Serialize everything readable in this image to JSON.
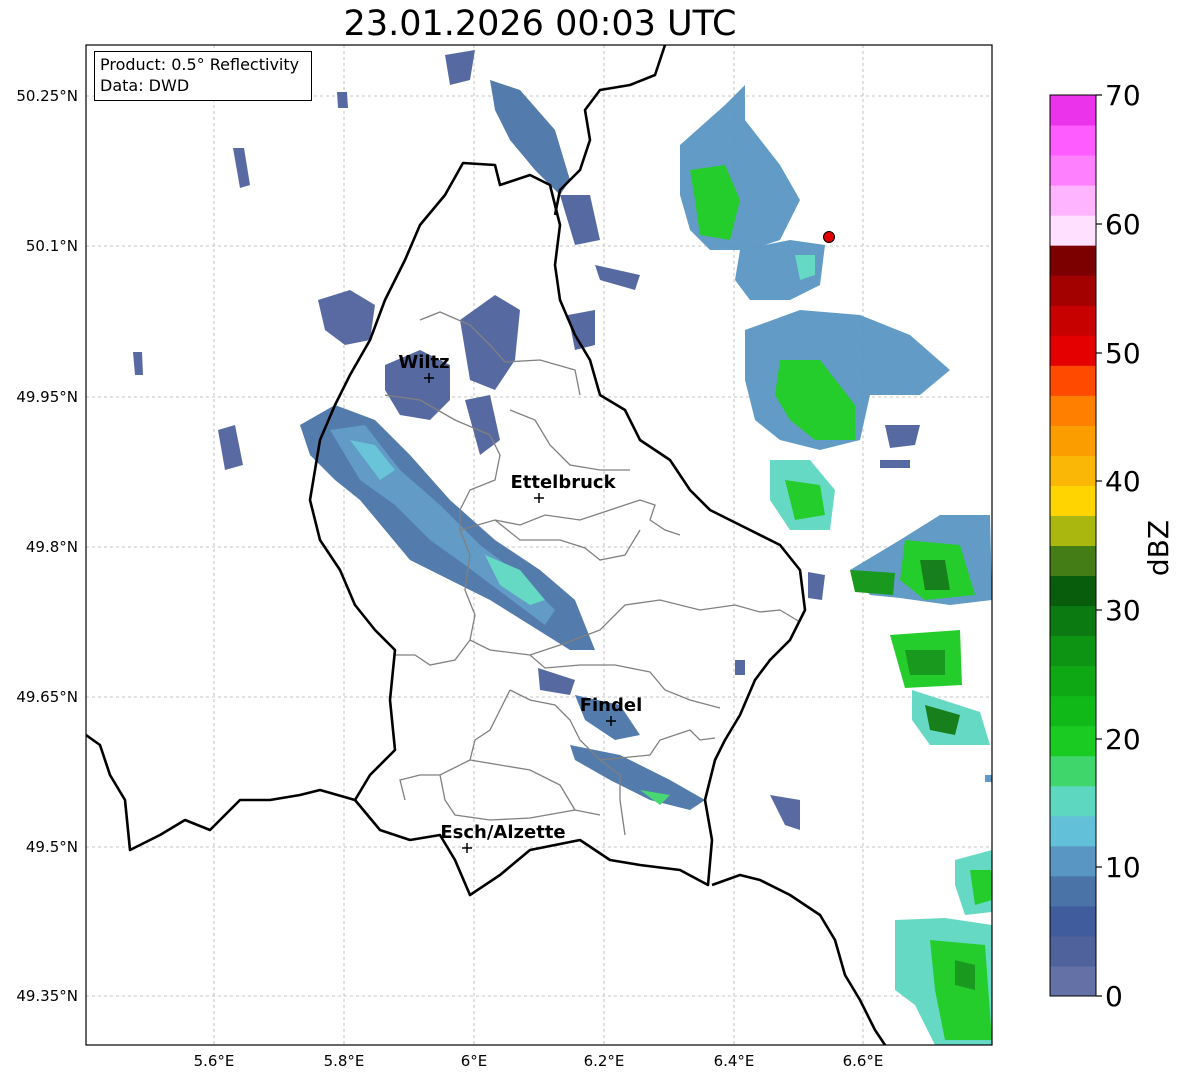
{
  "title": "23.01.2026 00:03 UTC",
  "info": {
    "product": "Product: 0.5° Reflectivity",
    "data": "Data: DWD"
  },
  "axes": {
    "lat_ticks": [
      "50.25°N",
      "50.1°N",
      "49.95°N",
      "49.8°N",
      "49.65°N",
      "49.5°N",
      "49.35°N"
    ],
    "lon_ticks": [
      "5.6°E",
      "5.8°E",
      "6°E",
      "6.2°E",
      "6.4°E",
      "6.6°E"
    ]
  },
  "cities": [
    {
      "name": "Wiltz",
      "lon": 5.93,
      "lat": 49.966
    },
    {
      "name": "Ettelbruck",
      "lon": 6.1,
      "lat": 49.847
    },
    {
      "name": "Findel",
      "lon": 6.21,
      "lat": 49.627
    },
    {
      "name": "Esch/Alzette",
      "lon": 5.99,
      "lat": 49.499
    }
  ],
  "marker": {
    "lon": 6.55,
    "lat": 50.11,
    "color": "#e00000"
  },
  "colorbar": {
    "label": "dBZ",
    "ticks": [
      "0",
      "10",
      "20",
      "30",
      "40",
      "50",
      "60",
      "70"
    ],
    "colors": [
      "#6471a6",
      "#4f629c",
      "#415c9d",
      "#4a74a8",
      "#5996c3",
      "#62c0d8",
      "#5ed7c1",
      "#3fd66c",
      "#1acb21",
      "#10b818",
      "#0ea815",
      "#0d9412",
      "#0b7a10",
      "#075d0c",
      "#447c16",
      "#aab70e",
      "#ffd400",
      "#fbb705",
      "#fb9c00",
      "#ff7f00",
      "#ff4a00",
      "#e50000",
      "#c70000",
      "#a30000",
      "#7d0000",
      "#ffe0ff",
      "#ffb4ff",
      "#ff80ff",
      "#ff5cff",
      "#ec33ec"
    ]
  }
}
